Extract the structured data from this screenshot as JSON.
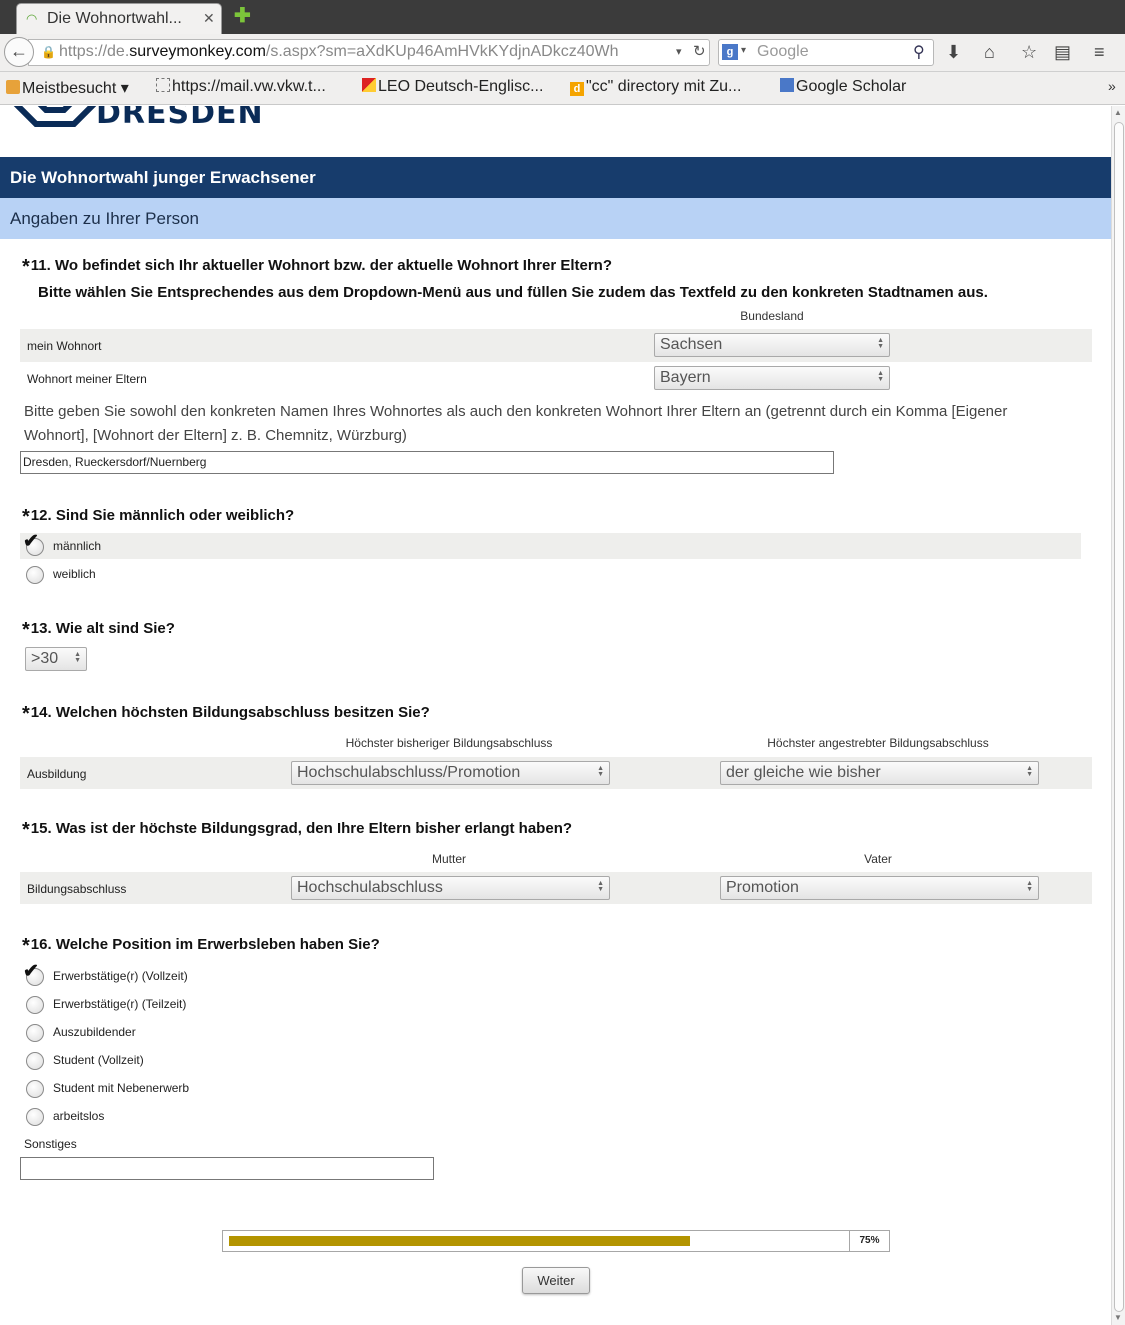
{
  "browser": {
    "tab_title": "Die Wohnortwahl...",
    "tab_close": "✕",
    "new_tab": "✚",
    "url_prefix": "https://de.",
    "url_domain": "surveymonkey.com",
    "url_rest": "/s.aspx?sm=aXdKUp46AmHVkKYdjnADkcz40Wh",
    "search_placeholder": "Google",
    "bookmarks": [
      "Meistbesucht",
      "https://mail.vw.vkw.t...",
      "LEO Deutsch-Englisc...",
      "\"cc\" directory mit Zu...",
      "Google Scholar"
    ],
    "more": "»"
  },
  "page": {
    "logo_text": "DRESDEN",
    "survey_title": "Die Wohnortwahl junger Erwachsener",
    "section_title": "Angaben zu Ihrer Person"
  },
  "q11": {
    "star": "*",
    "title": "11. Wo befindet sich Ihr aktueller Wohnort bzw. der aktuelle Wohnort Ihrer Eltern?",
    "subtitle": "Bitte wählen Sie Entsprechendes aus dem Dropdown-Menü aus und füllen Sie zudem das Textfeld zu den konkreten Stadtnamen aus.",
    "column": "Bundesland",
    "rows": [
      {
        "label": "mein Wohnort",
        "value": "Sachsen"
      },
      {
        "label": "Wohnort meiner Eltern",
        "value": "Bayern"
      }
    ],
    "note": "Bitte geben Sie sowohl den konkreten Namen Ihres Wohnortes als auch den konkreten Wohnort Ihrer Eltern an (getrennt durch ein Komma [Eigener Wohnort], [Wohnort der Eltern] z. B. Chemnitz, Würzburg)",
    "text_value": "Dresden, Rueckersdorf/Nuernberg"
  },
  "q12": {
    "star": "*",
    "title": "12. Sind Sie männlich oder weiblich?",
    "options": [
      "männlich",
      "weiblich"
    ],
    "selected": "männlich"
  },
  "q13": {
    "star": "*",
    "title": "13. Wie alt sind Sie?",
    "value": ">30"
  },
  "q14": {
    "star": "*",
    "title": "14. Welchen höchsten Bildungsabschluss besitzen Sie?",
    "col1": "Höchster bisheriger Bildungsabschluss",
    "col2": "Höchster angestrebter Bildungsabschluss",
    "row_label": "Ausbildung",
    "value1": "Hochschulabschluss/Promotion",
    "value2": "der gleiche wie bisher"
  },
  "q15": {
    "star": "*",
    "title": "15. Was ist der höchste Bildungsgrad, den Ihre Eltern bisher erlangt haben?",
    "col1": "Mutter",
    "col2": "Vater",
    "row_label": "Bildungsabschluss",
    "value1": "Hochschulabschluss",
    "value2": "Promotion"
  },
  "q16": {
    "star": "*",
    "title": "16. Welche Position im Erwerbsleben haben Sie?",
    "options": [
      "Erwerbstätige(r) (Vollzeit)",
      "Erwerbstätige(r) (Teilzeit)",
      "Auszubildender",
      "Student (Vollzeit)",
      "Student mit Nebenerwerb",
      "arbeitslos"
    ],
    "selected": "Erwerbstätige(r) (Vollzeit)",
    "other_label": "Sonstiges",
    "other_value": ""
  },
  "progress": {
    "label": "75%",
    "fraction": 0.75
  },
  "next_button": "Weiter",
  "colors": {
    "title_band": "#173c6c",
    "section_band": "#b8d2f5",
    "progress_fill": "#b39400"
  }
}
